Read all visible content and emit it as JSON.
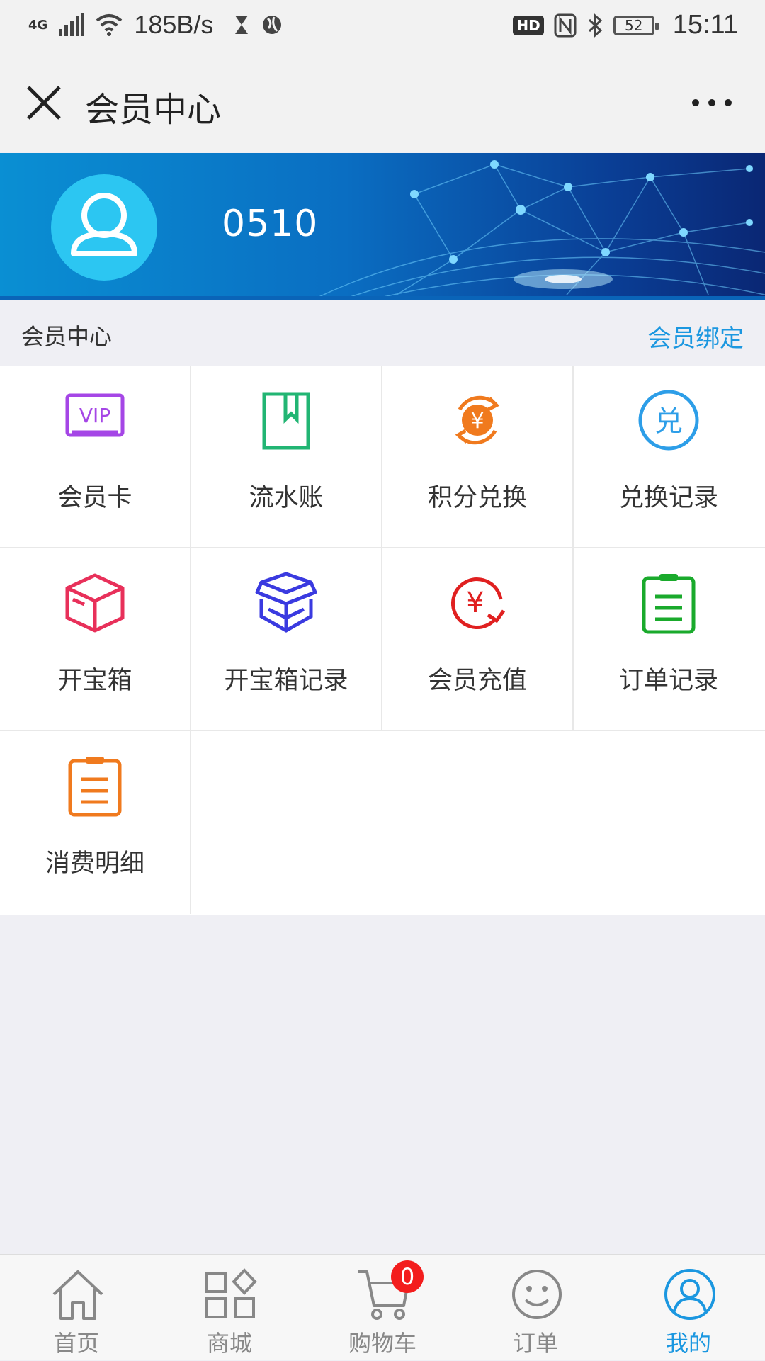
{
  "status_bar": {
    "network": "4G",
    "speed": "185B/s",
    "hd": "HD",
    "battery": "52",
    "time": "15:11"
  },
  "header": {
    "title": "会员中心"
  },
  "profile": {
    "username": "0510"
  },
  "section": {
    "title": "会员中心",
    "bind_link": "会员绑定"
  },
  "grid": {
    "items": [
      {
        "label": "会员卡",
        "icon": "vip-card-icon",
        "color": "#a546e6"
      },
      {
        "label": "流水账",
        "icon": "bookmark-book-icon",
        "color": "#22b573"
      },
      {
        "label": "积分兑换",
        "icon": "yen-exchange-icon",
        "color": "#f07a1e"
      },
      {
        "label": "兑换记录",
        "icon": "exchange-circle-icon",
        "color": "#2d9ee8"
      },
      {
        "label": "开宝箱",
        "icon": "box-icon",
        "color": "#e8305a"
      },
      {
        "label": "开宝箱记录",
        "icon": "open-box-icon",
        "color": "#3a3ae0"
      },
      {
        "label": "会员充值",
        "icon": "yen-recharge-icon",
        "color": "#e02020"
      },
      {
        "label": "订单记录",
        "icon": "clipboard-icon",
        "color": "#1aaa2c"
      },
      {
        "label": "消费明细",
        "icon": "clipboard-list-icon",
        "color": "#f07a1e"
      }
    ]
  },
  "bottom_nav": {
    "items": [
      {
        "label": "首页",
        "icon": "home-icon"
      },
      {
        "label": "商城",
        "icon": "apps-icon"
      },
      {
        "label": "购物车",
        "icon": "cart-icon"
      },
      {
        "label": "订单",
        "icon": "smile-icon"
      },
      {
        "label": "我的",
        "icon": "user-icon"
      }
    ],
    "cart_count": "0",
    "active_color": "#1b97e0"
  }
}
